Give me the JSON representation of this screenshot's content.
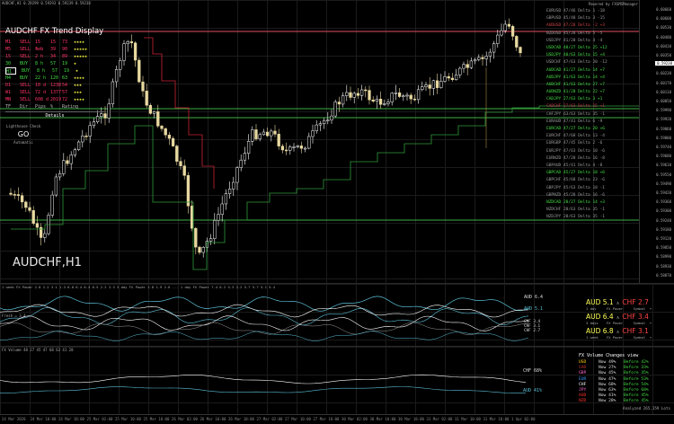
{
  "app": {
    "top_right_label": "Powered by FXSMSManager"
  },
  "main": {
    "symbol_label": "AUDCHF,H1",
    "info_text": "AUDCHF,H1 0.29299 0.59293 0.59239 0.59238",
    "yaxis": [
      "0.60660",
      "0.60600",
      "0.60530",
      "0.60480",
      "0.60410",
      "0.60350",
      "0.60280",
      "0.60230",
      "0.60170",
      "0.60110",
      "0.60050",
      "0.59990",
      "0.59920",
      "0.59860",
      "0.59800",
      "0.59740",
      "0.59680",
      "0.59610",
      "0.59550",
      "0.59490",
      "0.59420",
      "0.59360",
      "0.59300",
      "0.59240",
      "0.59180",
      "0.59120",
      "0.59050",
      "0.58990",
      "0.58930",
      "0.58870"
    ],
    "price_marker": "0.59238",
    "colors": {
      "up": "#ffffff",
      "down": "#e8d9a0",
      "accent": "#d9c27a",
      "hline_red": "#e05060",
      "hline_green": "#3cb043",
      "support": "#2f9a3a",
      "resist": "#cc2233"
    }
  },
  "trend_panel": {
    "title": "AUDCHF FX Trend Display",
    "rows": [
      {
        "tf": "M1",
        "dir": "SELL",
        "time": "15 sec",
        "v1": "15",
        "v2": "73",
        "stars": "★★★★",
        "color": "#ff3366"
      },
      {
        "tf": "M5",
        "dir": "SELL",
        "time": "3 h",
        "v1": "39",
        "v2": "90",
        "stars": "★★★★★",
        "color": "#ff3366"
      },
      {
        "tf": "15",
        "dir": "SELL",
        "time": "2 h",
        "v1": "34",
        "v2": "89",
        "stars": "★★★★★",
        "color": "#ff3366"
      },
      {
        "tf": "30",
        "dir": "BUY",
        "time": "8 h",
        "v1": "57",
        "v2": "19",
        "stars": "★",
        "color": "#44dd44"
      },
      {
        "tf": "H1",
        "dir": "BUY",
        "time": "8 h",
        "v1": "57",
        "v2": "19",
        "stars": "★",
        "color": "#44dd44"
      },
      {
        "tf": "H4",
        "dir": "BUY",
        "time": "22 h",
        "v1": "120",
        "v2": "63",
        "stars": "★★★★",
        "color": "#44dd44"
      },
      {
        "tf": "D1",
        "dir": "SELL",
        "time": "10 d",
        "v1": "1238",
        "v2": "54",
        "stars": "★★★",
        "color": "#ff3366"
      },
      {
        "tf": "W1",
        "dir": "SELL",
        "time": "72 d",
        "v1": "1377",
        "v2": "57",
        "stars": "★★★",
        "color": "#ff3366"
      },
      {
        "tf": "MN",
        "dir": "SELL",
        "time": "608 d",
        "v1": "2019",
        "v2": "72",
        "stars": "★★★★",
        "color": "#ff3366"
      }
    ],
    "footer": {
      "c1": "TF",
      "c2": "Dir",
      "c3": "Pips",
      "c4": "%",
      "c5": "Rating"
    },
    "details_label": "Details",
    "lightness_label": "Lighthouse Check",
    "go_label": "GO",
    "auto_label": "Automatic"
  },
  "pairs_panel": {
    "rows": [
      {
        "text": "EURUSD 47/46 Delta  1 -18",
        "color": "#999999"
      },
      {
        "text": "GBPUSD 45/48 Delta  3 -15",
        "color": "#999999"
      },
      {
        "text": "AUDUSD 47/28 Delta -2  +3",
        "color": "#cc4444"
      },
      {
        "text": "NZDUSD 45/28 Delta  5  -5",
        "color": "#999999"
      },
      {
        "text": "USDJPY 41/20 Delta  4  -4",
        "color": "#999999"
      },
      {
        "text": "USDCAD 48/27 Delta  25 +12",
        "color": "#44dd44"
      },
      {
        "text": "USDJPY 48/63 Delta  15  +4",
        "color": "#44dd44"
      },
      {
        "text": "USDCHF 47/63 Delta  20 -12",
        "color": "#999999"
      },
      {
        "text": "AUDCAD 41/27 Delta  14  +7",
        "color": "#44dd44"
      },
      {
        "text": "AUDJPY 41/63 Delta  14  +4",
        "color": "#44dd44"
      },
      {
        "text": "AUDCHF 41/63 Delta  27  +7",
        "color": "#44dd44"
      },
      {
        "text": "AUDNZD 41/28 Delta  22  +7",
        "color": "#44dd44"
      },
      {
        "text": "CADJPY 27/63 Delta  3  +1",
        "color": "#44dd44"
      },
      {
        "text": "CADCHF 27/63 Delta  15  +1",
        "color": "#cc3355"
      },
      {
        "text": "CHFJPY 63/63 Delta  35  -1",
        "color": "#999999"
      },
      {
        "text": "EURAUD 47/41 Delta  6  -9",
        "color": "#999999"
      },
      {
        "text": "EURCAD 47/27 Delta  20  +6",
        "color": "#44dd44"
      },
      {
        "text": "EURCHF 47/68 Delta  13  -4",
        "color": "#999999"
      },
      {
        "text": "EURGBP 47/45 Delta  2  -6",
        "color": "#999999"
      },
      {
        "text": "EURJPY 47/63 Delta  10  -6",
        "color": "#999999"
      },
      {
        "text": "EURNZD 47/28 Delta  16  -8",
        "color": "#999999"
      },
      {
        "text": "GBPAUD 45/41 Delta  4  -8",
        "color": "#999999"
      },
      {
        "text": "GBPCAD 45/27 Delta  18  +6",
        "color": "#44dd44"
      },
      {
        "text": "GBPCHF 45/68 Delta  23  -6",
        "color": "#999999"
      },
      {
        "text": "GBPJPY 45/63 Delta  18  -1",
        "color": "#999999"
      },
      {
        "text": "GBPNZD 45/28 Delta  16  -6",
        "color": "#999999"
      },
      {
        "text": "NZDCAD 28/27 Delta  14  +3",
        "color": "#44dd44"
      },
      {
        "text": "NZDCHF 28/63 Delta  35  -1",
        "color": "#999999"
      },
      {
        "text": "NZDJPY 28/63 Delta  35  -1",
        "color": "#999999"
      }
    ]
  },
  "power_pane": {
    "title": "1 week FX Power  2.8  2.2  3.1  1.3  6.0  6.4  6.4  6.5  2.2  3.3   3 day FX Power  2.8  1.9  2.6  ...  1 day FX Power  7.4  6.2  5.3  2.2  5.7  5.7  5.1  5.4",
    "sub_label": "Fresh = 3.4",
    "right_labels": [
      {
        "text": "AUD 6.4",
        "color": "#dddddd"
      },
      {
        "text": "AUD 5.1",
        "color": "#5bc0d8"
      }
    ],
    "stack_labels": [
      "CHF 3.4",
      "CHF 3.1",
      "CHF 2.7"
    ],
    "rows": [
      {
        "left": "AUD 5.1",
        "right": "CHF 2.7",
        "lc": "#ffff55",
        "rc": "#ff4444",
        "sub": "1 day     FX Power     Symbol  ▾"
      },
      {
        "left": "AUD 6.4",
        "right": "CHF 3.4",
        "lc": "#ffff55",
        "rc": "#ff4444",
        "sub": "3 days    FX Power     Symbol  ▾"
      },
      {
        "left": "AUD 6.8",
        "right": "CHF 3.1",
        "lc": "#ffff55",
        "rc": "#ff4444",
        "sub": "1 week    FX Power     Symbol  ▾"
      }
    ]
  },
  "volume_pane": {
    "title": "FX Volume 48 27 45 47 68 63 41 28",
    "right_labels": [
      {
        "text": "CHF 68%",
        "color": "#dddddd"
      },
      {
        "text": "AUD 41%",
        "color": "#5bc0d8"
      }
    ],
    "list_title": "FX Volume Changes view",
    "rows": [
      {
        "cur": "USD",
        "now": "Now  49%",
        "before": "Before 42%",
        "color": "#ffcc00"
      },
      {
        "cur": "CAD",
        "now": "Now  27%",
        "before": "Before 33%",
        "color": "#cc3333"
      },
      {
        "cur": "GBP",
        "now": "Now  45%",
        "before": "Before 45%",
        "color": "#ff66cc"
      },
      {
        "cur": "EUR",
        "now": "Now  47%",
        "before": "Before 53%",
        "color": "#3399ff"
      },
      {
        "cur": "CHF",
        "now": "Now  68%",
        "before": "Before 54%",
        "color": "#ffffff"
      },
      {
        "cur": "JPY",
        "now": "Now  63%",
        "before": "Before 68%",
        "color": "#ff66cc"
      },
      {
        "cur": "AUD",
        "now": "Now  41%",
        "before": "Before 45%",
        "color": "#ff3333"
      },
      {
        "cur": "NZD",
        "now": "Now  28%",
        "before": "Before 45%",
        "color": "#ff3333"
      }
    ],
    "footer": "Analyzed 265,159 Lots"
  },
  "xaxis": [
    "24 Mar 2020",
    "24 Mar 10:00",
    "24 Mar 18:00",
    "25 Mar 02:00",
    "25 Mar 10:00",
    "25 Mar 18:00",
    "26 Mar 02:00",
    "26 Mar 10:00",
    "26 Mar 18:00",
    "27 Mar 02:00",
    "27 Mar 10:00",
    "27 Mar 18:00",
    "30 Mar 02:00",
    "30 Mar 10:00",
    "30 Mar 18:00",
    "31 Mar 02:00",
    "31 Mar 10:00",
    "31 Mar 18:00",
    "1 Apr 02:00"
  ]
}
